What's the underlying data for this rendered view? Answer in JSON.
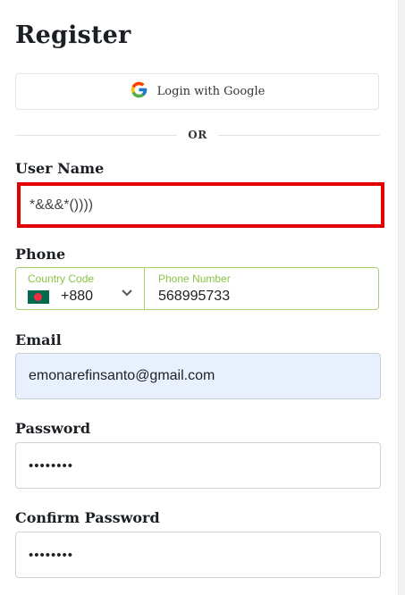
{
  "form": {
    "title": "Register",
    "google_button_label": "Login with Google",
    "divider_text": "OR",
    "username": {
      "label": "User Name",
      "value": "*&&&*())))"
    },
    "phone": {
      "label": "Phone",
      "country_code_label": "Country Code",
      "country_code_value": "+880",
      "country_flag": "bangladesh-flag",
      "number_label": "Phone Number",
      "number_value": "568995733"
    },
    "email": {
      "label": "Email",
      "value": "emonarefinsanto@gmail.com"
    },
    "password": {
      "label": "Password",
      "value": "••••••••"
    },
    "confirm_password": {
      "label": "Confirm Password",
      "value": "••••••••"
    }
  },
  "colors": {
    "highlight_border": "#e20000",
    "phone_border": "#a8d16d",
    "phone_label": "#8bc34a",
    "autofill_bg": "#e8f0fe"
  },
  "icons": {
    "google": "google-logo-icon",
    "dropdown": "chevron-down-icon"
  }
}
